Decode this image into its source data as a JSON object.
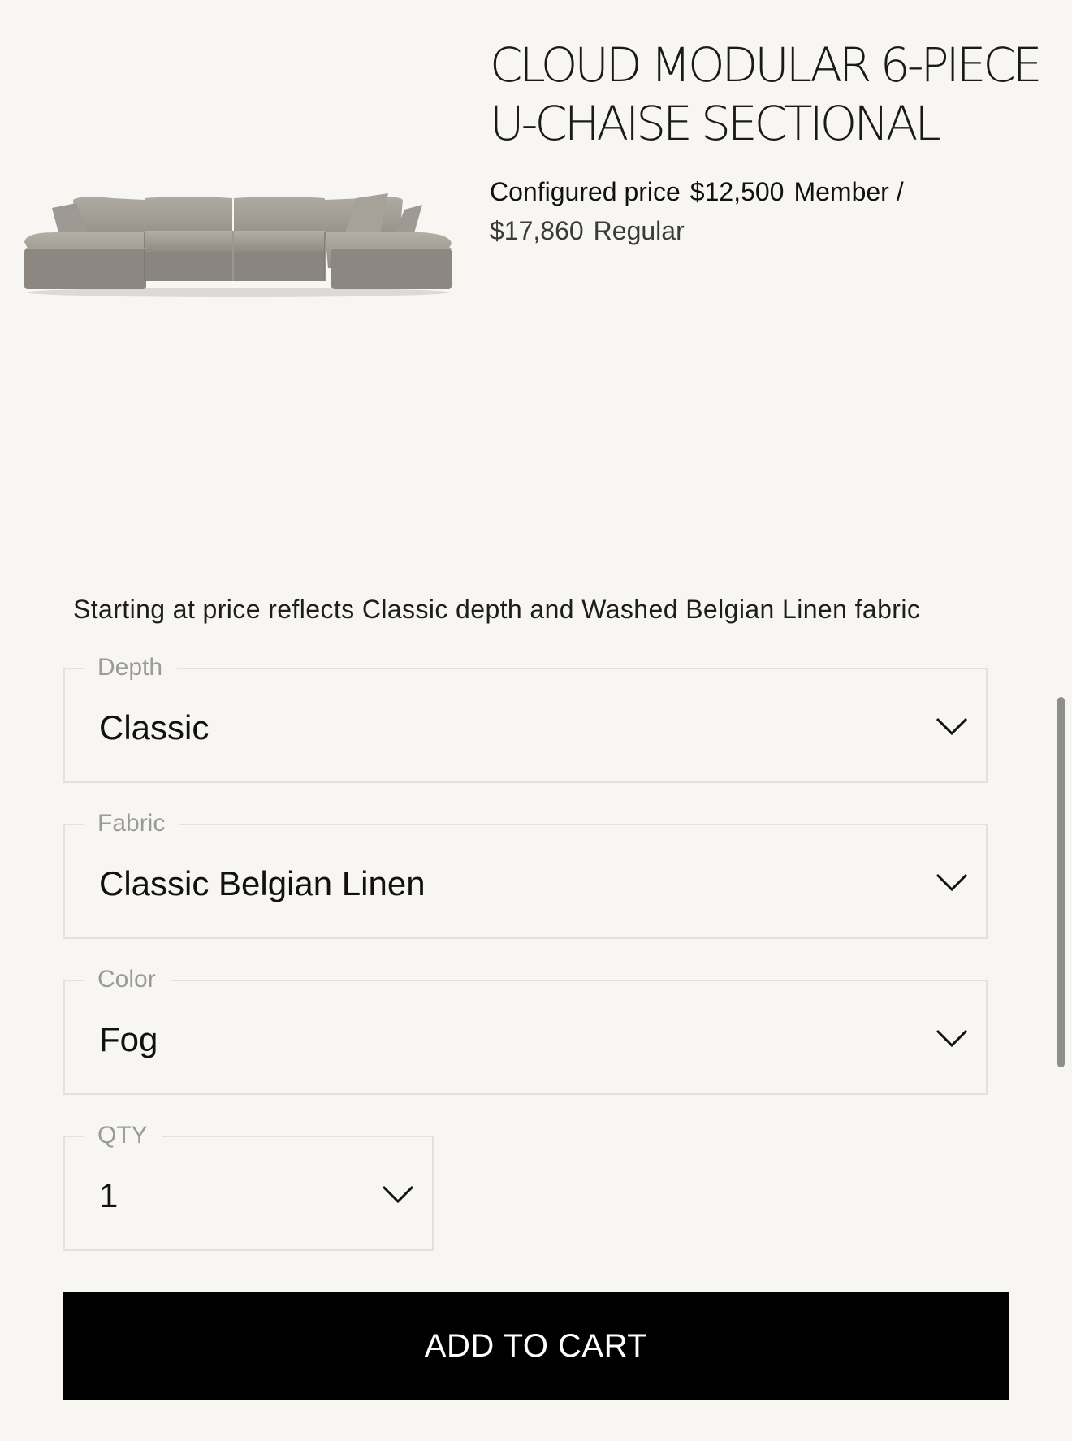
{
  "product": {
    "title_line1": "CLOUD MODULAR 6-PIECE",
    "title_line2": "U-CHAISE SECTIONAL",
    "image_label": "sofa-image",
    "configured_label": "Configured price",
    "member_price": "$12,500",
    "member_label": "Member /",
    "regular_price": "$17,860",
    "regular_label": "Regular"
  },
  "disclaimer": "Starting at price reflects Classic depth and Washed Belgian Linen fabric",
  "options": {
    "depth": {
      "label": "Depth",
      "value": "Classic"
    },
    "fabric": {
      "label": "Fabric",
      "value": "Classic Belgian Linen"
    },
    "color": {
      "label": "Color",
      "value": "Fog"
    },
    "qty": {
      "label": "QTY",
      "value": "1"
    }
  },
  "cart": {
    "button_label": "ADD TO CART"
  },
  "icons": {
    "dropdown": "chevron-down-icon"
  },
  "colors": {
    "background": "#f7f6f3",
    "button": "#000000",
    "sofa": "#a29e96"
  }
}
